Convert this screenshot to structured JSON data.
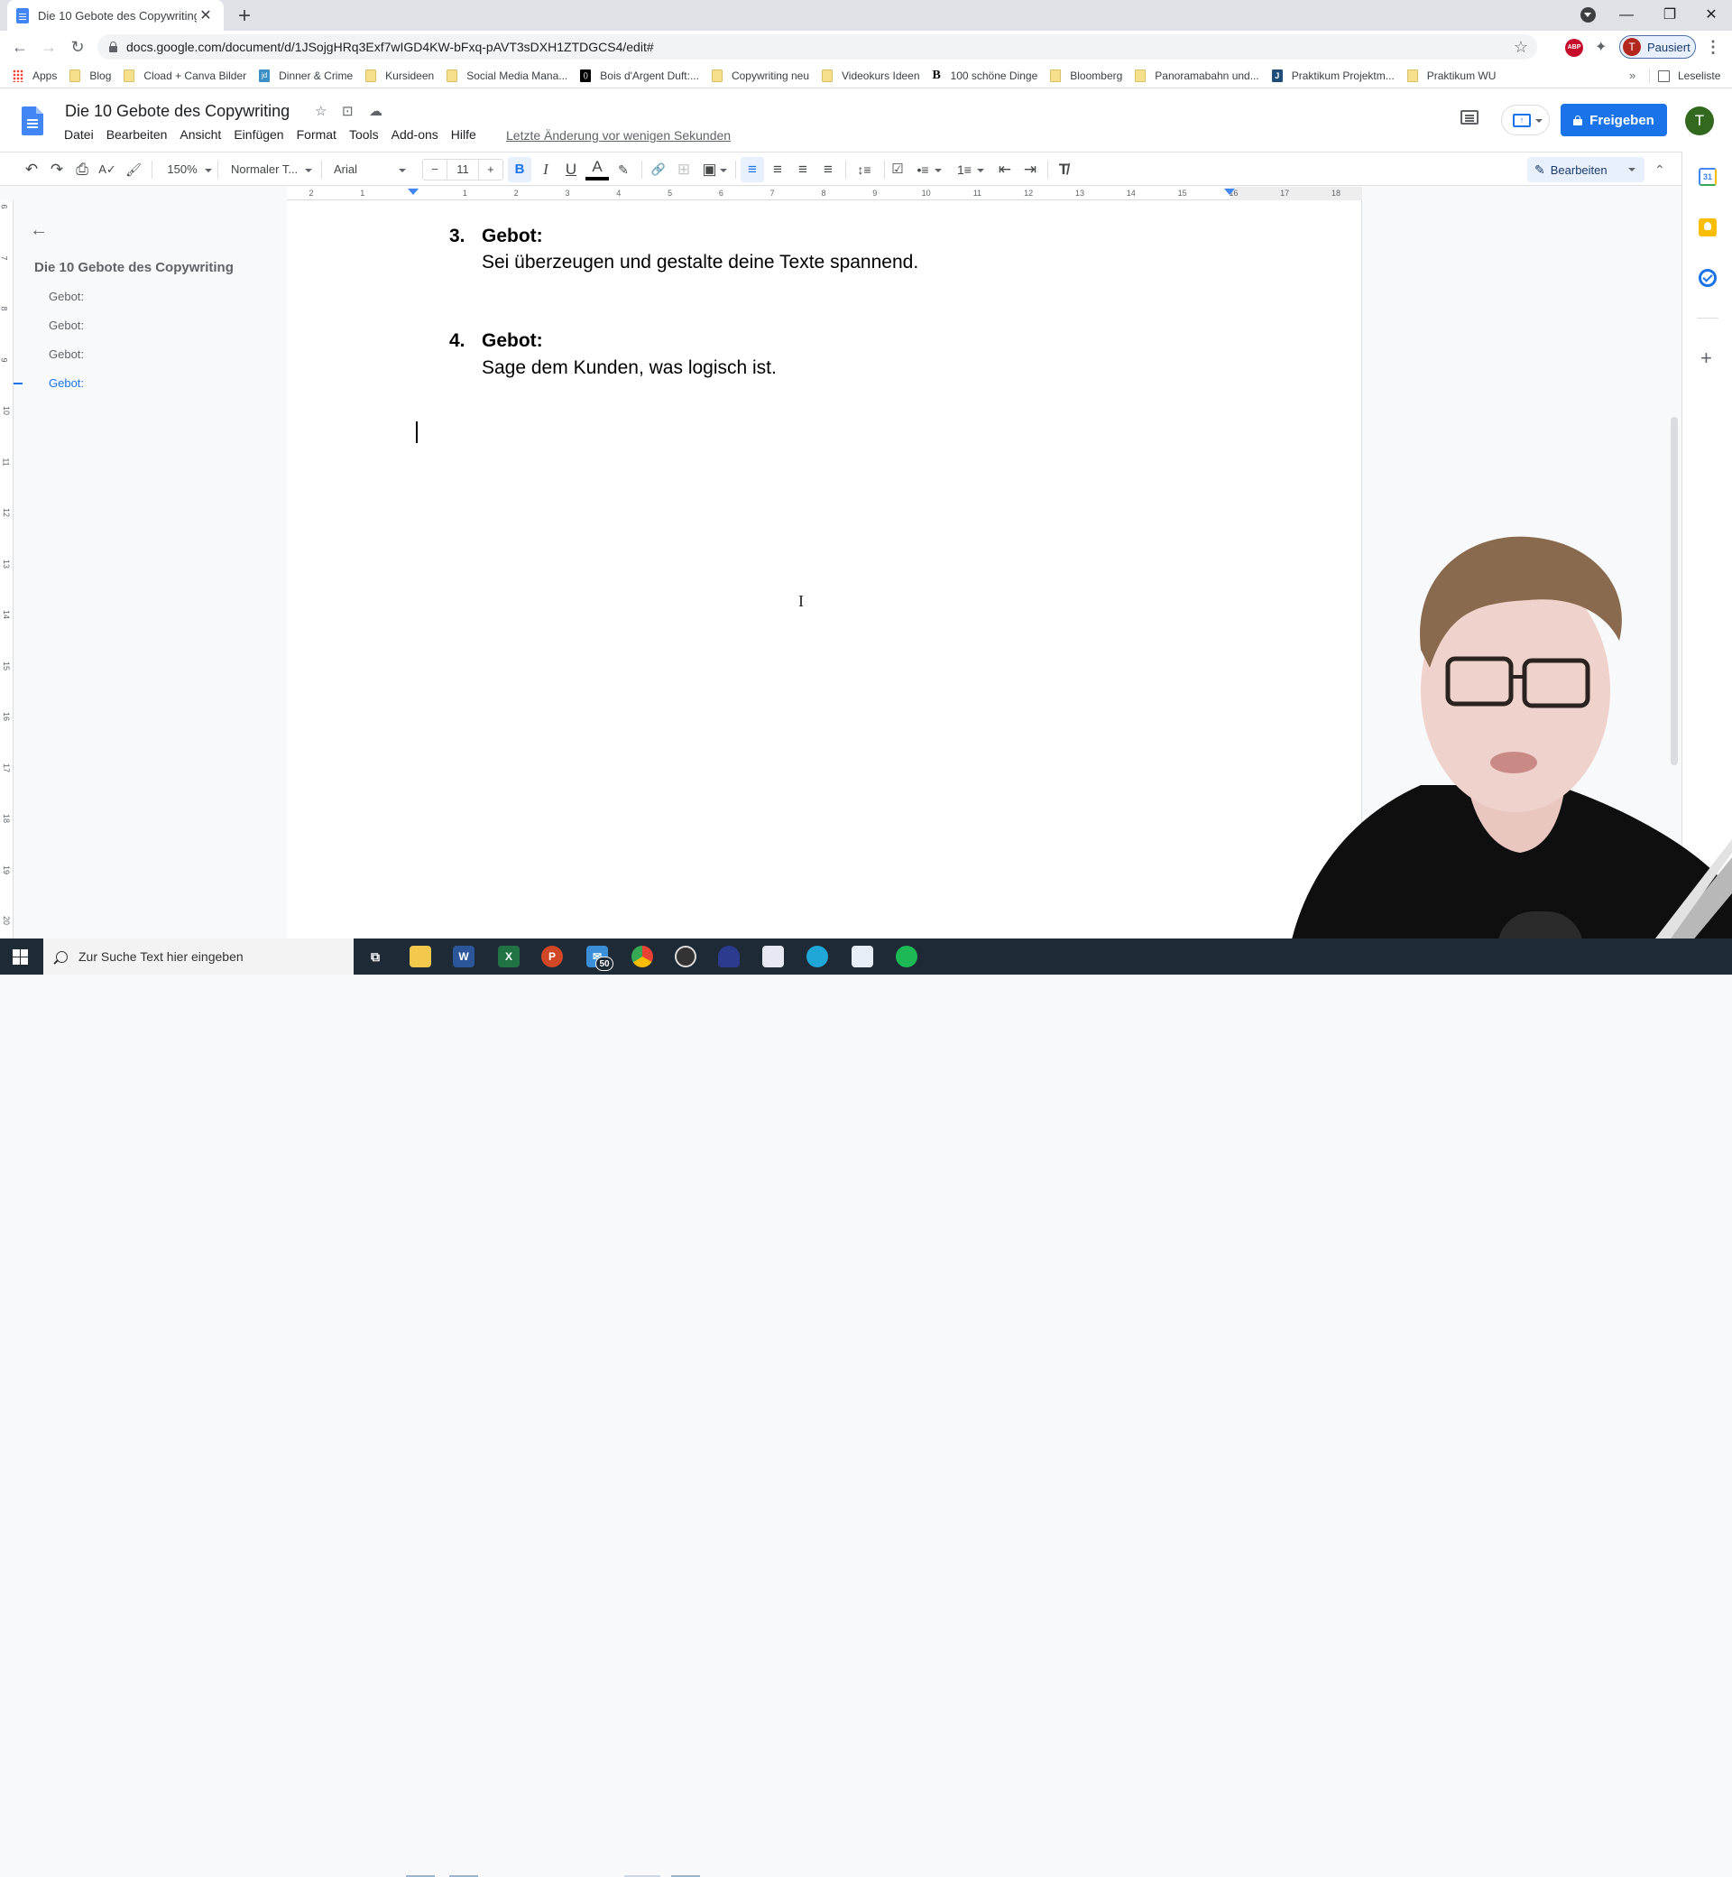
{
  "browser": {
    "tab_title": "Die 10 Gebote des Copywriting - ",
    "tab_close": "✕",
    "new_tab": "+",
    "url": "docs.google.com/document/d/1JSojgHRq3Exf7wIGD4KW-bFxq-pAVT3sDXH1ZTDGCS4/edit#",
    "profile_label": "Pausiert",
    "profile_initial": "T",
    "abp_label": "ABP",
    "window_controls": {
      "minimize": "—",
      "restore": "❐",
      "close": "✕"
    },
    "nav": {
      "back": "←",
      "forward": "→",
      "reload": "↻",
      "star": "☆",
      "menu": "⋮",
      "extensions": "✦"
    }
  },
  "bookmarks": {
    "items": [
      {
        "label": "Apps",
        "icon": "apps-grid-icon"
      },
      {
        "label": "Blog",
        "icon": "folder-icon"
      },
      {
        "label": "Cload + Canva Bilder",
        "icon": "folder-icon"
      },
      {
        "label": "Dinner & Crime",
        "icon": "jd-favicon"
      },
      {
        "label": "Kursideen",
        "icon": "folder-icon"
      },
      {
        "label": "Social Media Mana...",
        "icon": "folder-icon"
      },
      {
        "label": "Bois d'Argent Duft:...",
        "icon": "bois-favicon"
      },
      {
        "label": "Copywriting neu",
        "icon": "folder-icon"
      },
      {
        "label": "Videokurs Ideen",
        "icon": "folder-icon"
      },
      {
        "label": "100 schöne Dinge",
        "icon": "b-favicon"
      },
      {
        "label": "Bloomberg",
        "icon": "folder-icon"
      },
      {
        "label": "Panoramabahn und...",
        "icon": "folder-icon"
      },
      {
        "label": "Praktikum Projektm...",
        "icon": "j-favicon"
      },
      {
        "label": "Praktikum WU",
        "icon": "folder-icon"
      }
    ],
    "more": "»",
    "reading_list": "Leseliste"
  },
  "docs": {
    "title": "Die 10 Gebote des Copywriting",
    "menu": [
      "Datei",
      "Bearbeiten",
      "Ansicht",
      "Einfügen",
      "Format",
      "Tools",
      "Add-ons",
      "Hilfe"
    ],
    "last_edit": "Letzte Änderung vor wenigen Sekunden",
    "share_label": "Freigeben",
    "user_initial": "T",
    "icons": {
      "star": "☆",
      "move": "⊡",
      "cloud": "☁"
    }
  },
  "toolbar": {
    "undo": "↶",
    "redo": "↷",
    "print": "⎙",
    "spellcheck": "A✓",
    "paint_format": "🖌",
    "zoom": "150%",
    "style": "Normaler T...",
    "font": "Arial",
    "font_size_minus": "−",
    "font_size": "11",
    "font_size_plus": "+",
    "bold": "B",
    "italic": "I",
    "underline": "U",
    "text_color": "A",
    "highlight": "✎",
    "link": "🔗",
    "comment": "⊞",
    "image": "▣",
    "align_left": "≡",
    "align_center": "≡",
    "align_right": "≡",
    "justify": "≡",
    "line_spacing": "↕≡",
    "checklist": "☑",
    "bullets": "•≡",
    "numbered": "1≡",
    "indent_less": "⇤",
    "indent_more": "⇥",
    "clear_format": "T̸",
    "mode": "Bearbeiten",
    "collapse": "⌃"
  },
  "ruler": {
    "h_ticks": [
      "2",
      "1",
      "",
      "1",
      "2",
      "3",
      "4",
      "5",
      "6",
      "7",
      "8",
      "9",
      "10",
      "11",
      "12",
      "13",
      "14",
      "15",
      "16",
      "17",
      "18"
    ],
    "v_ticks": [
      "6",
      "7",
      "8",
      "9",
      "10",
      "11",
      "12",
      "13",
      "14",
      "15",
      "16",
      "17",
      "18",
      "19",
      "20"
    ]
  },
  "outline": {
    "back": "←",
    "title": "Die 10 Gebote des Copywriting",
    "items": [
      {
        "label": "Gebot:",
        "active": false
      },
      {
        "label": "Gebot:",
        "active": false
      },
      {
        "label": "Gebot:",
        "active": false
      },
      {
        "label": "Gebot:",
        "active": true
      }
    ]
  },
  "document": {
    "items": [
      {
        "number": "3.",
        "heading": "Gebot:",
        "body": "Sei überzeugen und gestalte deine Texte spannend."
      },
      {
        "number": "4.",
        "heading": "Gebot:",
        "body": "Sage dem Kunden, was logisch ist."
      }
    ],
    "ibeam": "I"
  },
  "side_panel": {
    "calendar": "31",
    "add": "+"
  },
  "taskbar": {
    "search_placeholder": "Zur Suche Text hier eingeben",
    "mail_badge": "50",
    "apps": [
      "task-view",
      "file-explorer",
      "word",
      "excel",
      "powerpoint",
      "mail",
      "chrome",
      "obs",
      "app-a",
      "app-b",
      "edge",
      "notepad",
      "spotify"
    ]
  },
  "colors": {
    "accent": "#1a73e8",
    "share_button": "#1a73e8",
    "avatar_green": "#33691e",
    "profile_red": "#b3261e",
    "taskbar": "#1f2a37"
  }
}
